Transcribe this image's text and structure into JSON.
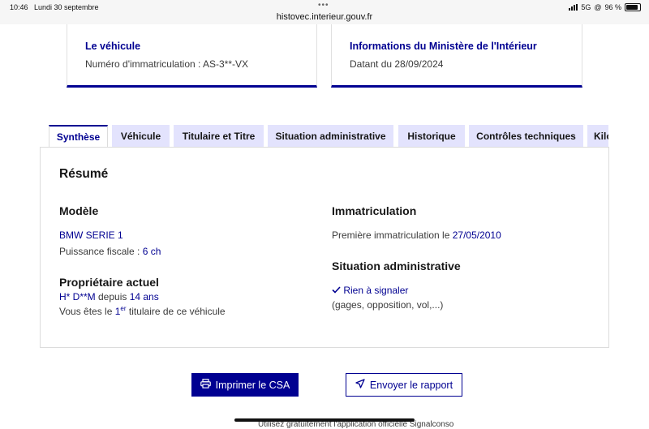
{
  "statusbar": {
    "time": "10:46",
    "date": "Lundi 30 septembre",
    "url": "histovec.interieur.gouv.fr",
    "network": "5G",
    "battery": "96 %"
  },
  "cards": {
    "vehicle": {
      "title": "Le véhicule",
      "text": "Numéro d'immatriculation : AS-3**-VX"
    },
    "ministere": {
      "title": "Informations du Ministère de l'Intérieur",
      "text": "Datant du 28/09/2024"
    }
  },
  "tabs": [
    {
      "label": "Synthèse",
      "active": true
    },
    {
      "label": "Véhicule",
      "active": false
    },
    {
      "label": "Titulaire et Titre",
      "active": false
    },
    {
      "label": "Situation administrative",
      "active": false
    },
    {
      "label": "Historique",
      "active": false
    },
    {
      "label": "Contrôles techniques",
      "active": false
    },
    {
      "label": "Kilo",
      "active": false
    }
  ],
  "summary": {
    "title": "Résumé",
    "modele": {
      "heading": "Modèle",
      "name": "BMW SERIE 1",
      "puissance_label": "Puissance fiscale : ",
      "puissance_value": "6 ch"
    },
    "proprietaire": {
      "heading": "Propriétaire actuel",
      "name": "H* D**M",
      "depuis_label": " depuis ",
      "depuis_value": "14 ans",
      "rank_prefix": "Vous êtes le ",
      "rank_number": "1",
      "rank_sup": "er",
      "rank_suffix": " titulaire de ce véhicule"
    },
    "immatriculation": {
      "heading": "Immatriculation",
      "label": "Première immatriculation le ",
      "date": "27/05/2010"
    },
    "situation": {
      "heading": "Situation administrative",
      "status": "Rien à signaler",
      "detail": "(gages, opposition, vol,...)"
    }
  },
  "actions": {
    "print_label": "Imprimer le CSA",
    "send_label": "Envoyer le rapport"
  },
  "footer_peek": "Utilisez gratuitement l'application officielle Signalconso"
}
